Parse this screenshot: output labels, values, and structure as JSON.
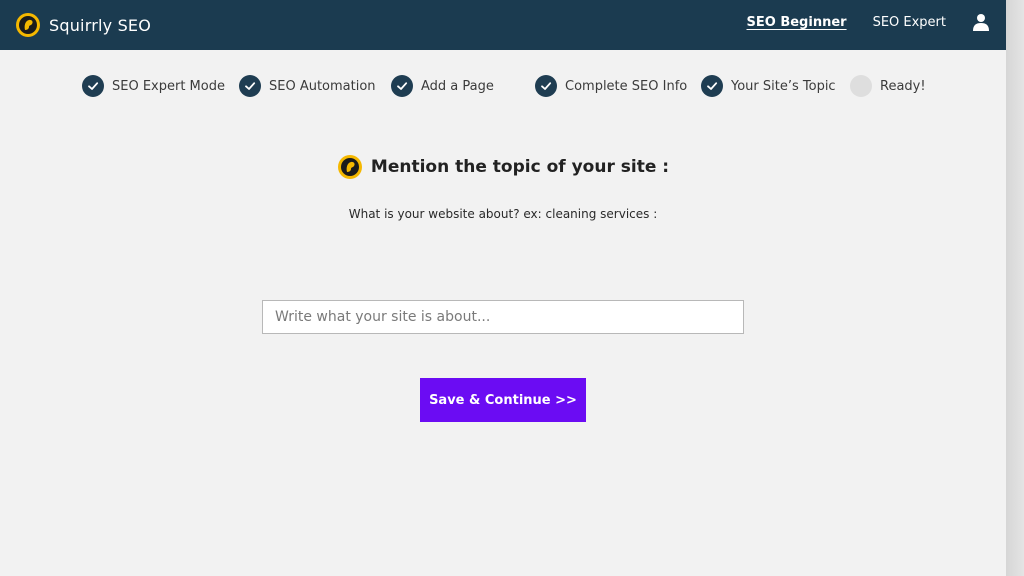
{
  "header": {
    "brand_name": "Squirrly SEO",
    "nav": [
      {
        "label": "SEO Beginner",
        "active": true
      },
      {
        "label": "SEO Expert",
        "active": false
      }
    ]
  },
  "steps": [
    {
      "label": "SEO Expert Mode",
      "done": true
    },
    {
      "label": "SEO Automation",
      "done": true
    },
    {
      "label": "Add a Page",
      "done": true
    },
    {
      "label": "Complete SEO Info",
      "done": true
    },
    {
      "label": "Your Site’s Topic",
      "done": true
    },
    {
      "label": "Ready!",
      "done": false
    }
  ],
  "main": {
    "heading": "Mention the topic of your site :",
    "subtext": "What is your website about? ex: cleaning services :",
    "input_value": "",
    "input_placeholder": "Write what your site is about...",
    "button_label": "Save & Continue >>"
  },
  "colors": {
    "header_bg": "#1b3b50",
    "step_done": "#1f3d52",
    "step_pending": "#dedede",
    "button_bg": "#6b0cf3",
    "logo_ring": "#f5b800"
  },
  "icons": {
    "logo": "squirrel-logo-icon",
    "user": "user-icon",
    "step_done": "checkmark-icon"
  }
}
